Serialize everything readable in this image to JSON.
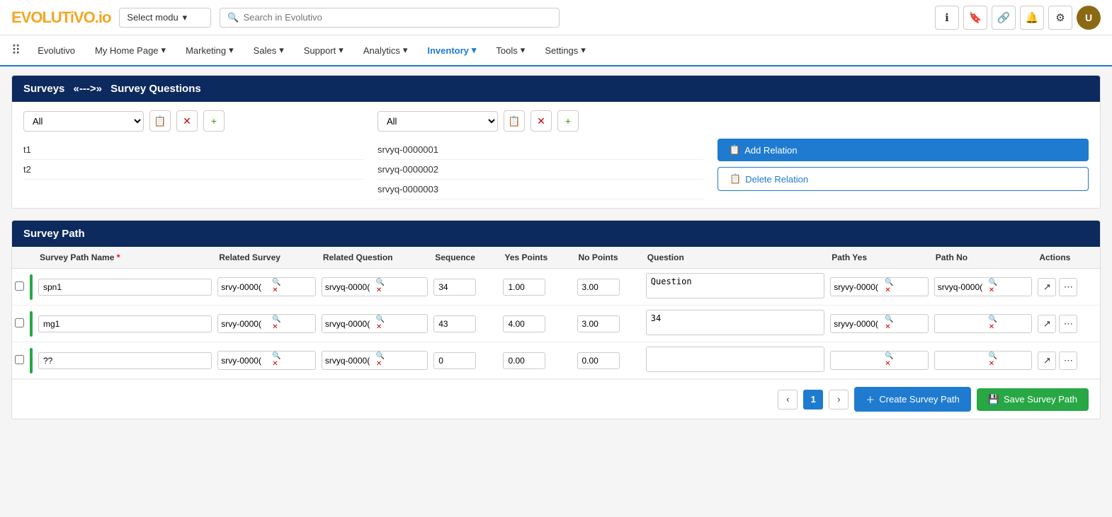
{
  "logo": {
    "brand": "EVOLUTiVO",
    "tld": ".io"
  },
  "topbar": {
    "module_placeholder": "Select modu",
    "search_placeholder": "Search in Evolutivo"
  },
  "nav": {
    "grid_icon": "⋮⋮⋮",
    "brand_label": "Evolutivo",
    "items": [
      {
        "label": "My Home Page",
        "has_dropdown": true
      },
      {
        "label": "Marketing",
        "has_dropdown": true
      },
      {
        "label": "Sales",
        "has_dropdown": true
      },
      {
        "label": "Support",
        "has_dropdown": true
      },
      {
        "label": "Analytics",
        "has_dropdown": true
      },
      {
        "label": "Inventory",
        "has_dropdown": true,
        "active": true
      },
      {
        "label": "Tools",
        "has_dropdown": true
      },
      {
        "label": "Settings",
        "has_dropdown": true
      }
    ]
  },
  "page": {
    "breadcrumb_left": "Surveys",
    "breadcrumb_sep": "«--->»",
    "breadcrumb_right": "Survey Questions"
  },
  "relation_section": {
    "left_filter_default": "All",
    "right_filter_default": "All",
    "left_items": [
      "t1",
      "t2"
    ],
    "right_items": [
      "srvyq-0000001",
      "srvyq-0000002",
      "srvyq-0000003"
    ],
    "add_relation_label": "Add Relation",
    "delete_relation_label": "Delete Relation"
  },
  "survey_path": {
    "section_title": "Survey Path",
    "columns": [
      {
        "label": "Survey Path Name",
        "required": true
      },
      {
        "label": "Related Survey"
      },
      {
        "label": "Related Question"
      },
      {
        "label": "Sequence"
      },
      {
        "label": "Yes Points"
      },
      {
        "label": "No Points"
      },
      {
        "label": "Question"
      },
      {
        "label": "Path Yes"
      },
      {
        "label": "Path No"
      },
      {
        "label": "Actions"
      }
    ],
    "rows": [
      {
        "name": "spn1",
        "related_survey": "srvy-0000(",
        "related_question": "srvyq-0000(",
        "sequence": "34",
        "yes_points": "1.00",
        "no_points": "3.00",
        "question": "Question",
        "path_yes": "sryvy-0000(",
        "path_no": "srvyq-0000("
      },
      {
        "name": "mg1",
        "related_survey": "srvy-0000(",
        "related_question": "srvyq-0000(",
        "sequence": "43",
        "yes_points": "4.00",
        "no_points": "3.00",
        "question": "34",
        "path_yes": "sryvy-0000(",
        "path_no": ""
      },
      {
        "name": "??",
        "related_survey": "srvy-0000(",
        "related_question": "srvyq-0000(",
        "sequence": "0",
        "yes_points": "0.00",
        "no_points": "0.00",
        "question": "",
        "path_yes": "",
        "path_no": ""
      }
    ],
    "pagination": {
      "current_page": 1
    },
    "create_label": "Create Survey Path",
    "save_label": "Save Survey Path"
  }
}
